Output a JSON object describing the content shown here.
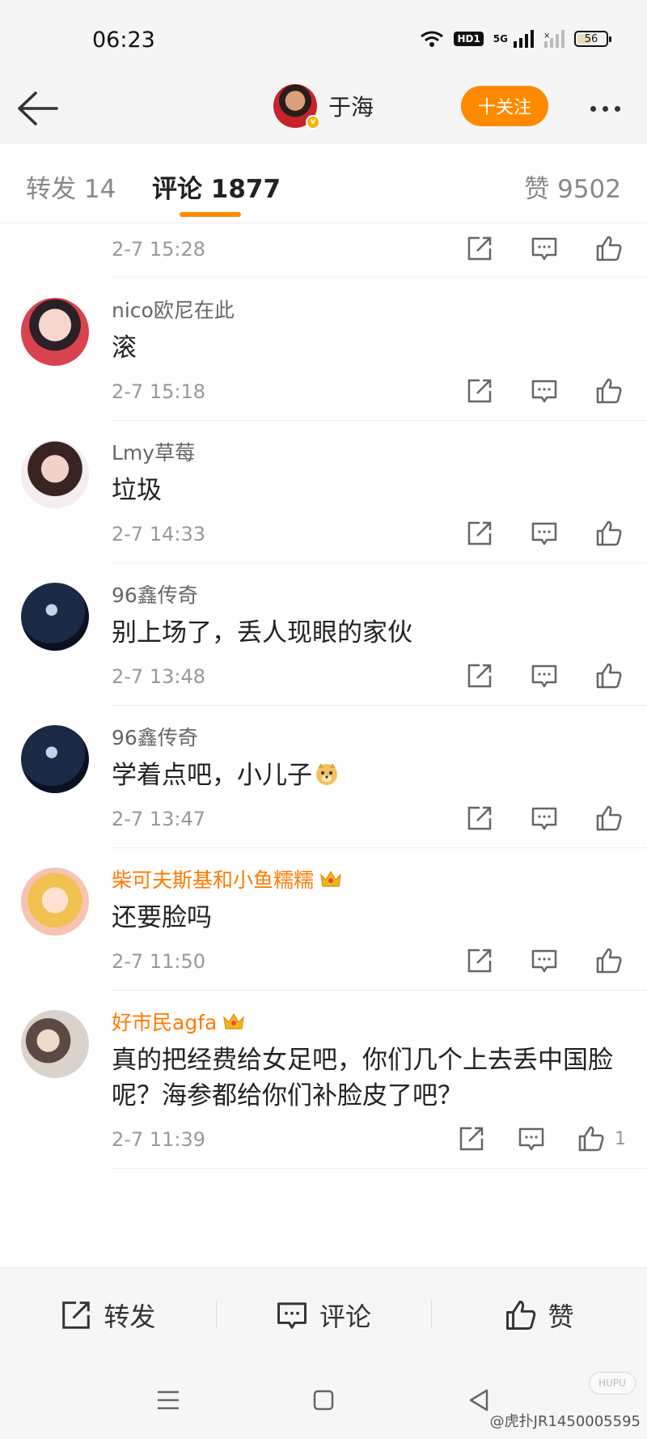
{
  "status_bar": {
    "time": "06:23",
    "hd_label": "HD1",
    "network_label": "5G",
    "battery_level": 56,
    "battery_label": "56"
  },
  "header": {
    "back_icon": "back-arrow-icon",
    "user_name": "于海",
    "follow_label": "十关注",
    "more_icon": "more-dots-icon"
  },
  "tabs": {
    "repost": "转发 14",
    "comment": "评论 1877",
    "like": "赞 9502"
  },
  "partial_comment": {
    "time": "2-7 15:28"
  },
  "comments": [
    {
      "name": "nico欧尼在此",
      "text": "滚",
      "time": "2-7 15:18"
    },
    {
      "name": "Lmy草莓",
      "text": "垃圾",
      "time": "2-7 14:33"
    },
    {
      "name": "96鑫传奇",
      "text": "别上场了，丢人现眼的家伙",
      "time": "2-7 13:48"
    },
    {
      "name": "96鑫传奇",
      "text": "学着点吧，小儿子",
      "time": "2-7 13:47"
    },
    {
      "name": "柴可夫斯基和小鱼糯糯",
      "text": "还要脸吗",
      "time": "2-7 11:50"
    },
    {
      "name": "好市民agfa",
      "text": "真的把经费给女足吧，你们几个上去丢中国脸呢？海参都给你们补脸皮了吧？",
      "time": "2-7 11:39",
      "likes": "1"
    }
  ],
  "bottom_bar": {
    "repost": "转发",
    "comment": "评论",
    "like": "赞"
  },
  "watermark": "@虎扑JR1450005595",
  "watermark_badge": "HUPU",
  "colors": {
    "accent": "#ff8a00",
    "vip_name": "#ff7a00",
    "muted": "#999999"
  }
}
